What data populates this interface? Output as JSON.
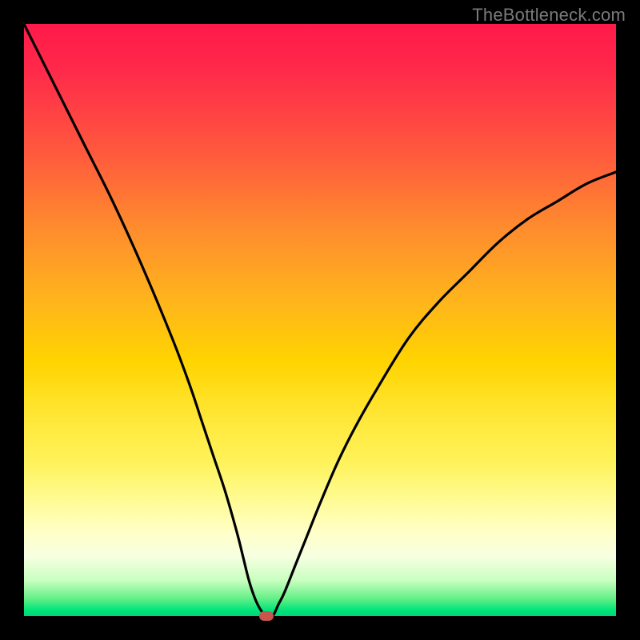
{
  "watermark": "TheBottleneck.com",
  "colors": {
    "background": "#000000",
    "gradient_top": "#ff1a4a",
    "gradient_bottom": "#00d47a",
    "curve": "#000000",
    "marker": "#c6564e",
    "watermark_text": "#7a7a7a"
  },
  "chart_data": {
    "type": "line",
    "title": "",
    "xlabel": "",
    "ylabel": "",
    "xlim": [
      0,
      100
    ],
    "ylim": [
      0,
      100
    ],
    "series": [
      {
        "name": "bottleneck-curve",
        "x": [
          0,
          5,
          10,
          15,
          20,
          25,
          28,
          30,
          32,
          34,
          36,
          37,
          38,
          39,
          40,
          41,
          42,
          43,
          44,
          46,
          48,
          50,
          53,
          56,
          60,
          65,
          70,
          75,
          80,
          85,
          90,
          95,
          100
        ],
        "y": [
          100,
          90,
          80,
          70,
          59,
          47,
          39,
          33,
          27,
          21,
          14,
          10,
          6,
          3,
          1,
          0,
          0,
          2,
          4,
          9,
          14,
          19,
          26,
          32,
          39,
          47,
          53,
          58,
          63,
          67,
          70,
          73,
          75
        ]
      }
    ],
    "marker": {
      "x": 41,
      "y": 0,
      "label": "optimal-point"
    },
    "axes_visible": false,
    "grid": false,
    "legend": false,
    "background_gradient": {
      "orientation": "vertical",
      "stops": [
        {
          "pos": 0.0,
          "color": "#ff1a4a"
        },
        {
          "pos": 0.22,
          "color": "#ff5a3d"
        },
        {
          "pos": 0.46,
          "color": "#ffb21e"
        },
        {
          "pos": 0.67,
          "color": "#ffe83a"
        },
        {
          "pos": 0.86,
          "color": "#ffffc8"
        },
        {
          "pos": 0.97,
          "color": "#66f088"
        },
        {
          "pos": 1.0,
          "color": "#00d47a"
        }
      ]
    }
  }
}
